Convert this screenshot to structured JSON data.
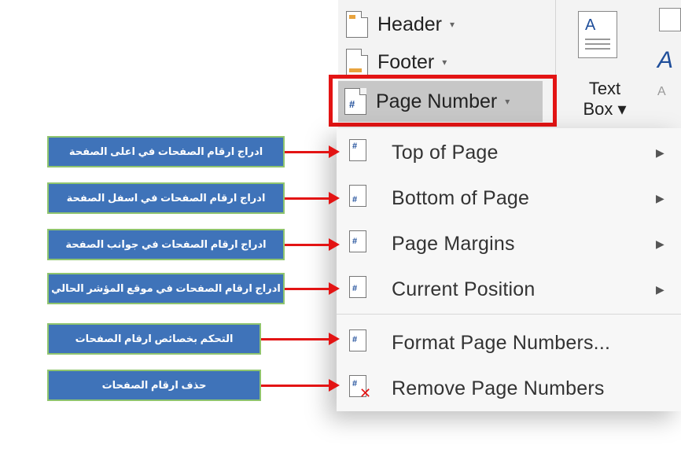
{
  "ribbon": {
    "header_label": "Header",
    "footer_label": "Footer",
    "page_number_label": "Page Number",
    "dropdown_glyph": "▾",
    "text_box_label_line1": "Text",
    "text_box_label_line2": "Box ▾",
    "textbox_glyph": "A",
    "hash_glyph": "#"
  },
  "menu": {
    "items": [
      {
        "label": "Top of Page",
        "has_submenu": true,
        "icon": "page-top-icon"
      },
      {
        "label": "Bottom of Page",
        "has_submenu": true,
        "icon": "page-bottom-icon"
      },
      {
        "label": "Page Margins",
        "has_submenu": true,
        "icon": "page-margins-icon"
      },
      {
        "label": "Current Position",
        "has_submenu": true,
        "icon": "page-current-icon"
      },
      {
        "label": "Format Page Numbers...",
        "has_submenu": false,
        "icon": "format-page-numbers-icon"
      },
      {
        "label": "Remove Page Numbers",
        "has_submenu": false,
        "icon": "remove-page-numbers-icon"
      }
    ],
    "submenu_arrow": "▶"
  },
  "annotations": [
    "ادراج ارقام الصفحات في اعلى الصفحة",
    "ادراج ارقام الصفحات في اسفل الصفحة",
    "ادراج ارقام الصفحات في جوانب الصفحة",
    "ادراج ارقام الصفحات في موقع المؤشر الحالي",
    "التحكم بخصائص ارقام الصفحات",
    "حذف ارقام الصفحات"
  ],
  "colors": {
    "highlight_border": "#e31414",
    "annotation_fill": "#3f73b9",
    "annotation_border": "#8fc46e",
    "arrow": "#e31414"
  }
}
